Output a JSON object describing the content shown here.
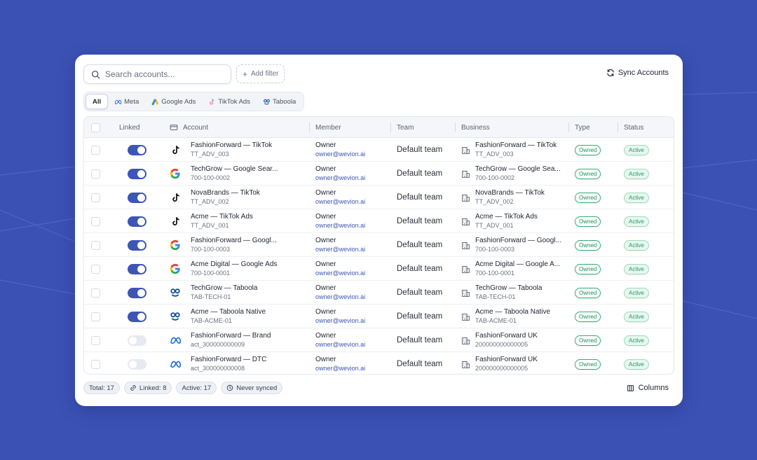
{
  "toolbar": {
    "search_placeholder": "Search accounts...",
    "add_filter_label": "Add filter",
    "sync_label": "Sync Accounts"
  },
  "tabs": [
    {
      "label": "All",
      "icon": "none",
      "active": true
    },
    {
      "label": "Meta",
      "icon": "meta-icon",
      "active": false
    },
    {
      "label": "Google Ads",
      "icon": "google-ads-icon",
      "active": false
    },
    {
      "label": "TikTok Ads",
      "icon": "tiktok-icon",
      "active": false
    },
    {
      "label": "Taboola",
      "icon": "taboola-icon",
      "active": false
    }
  ],
  "table": {
    "headers": {
      "linked": "Linked",
      "account": "Account",
      "member": "Member",
      "team": "Team",
      "business": "Business",
      "type": "Type",
      "status": "Status"
    },
    "rows": [
      {
        "linked": true,
        "platform": "tiktok",
        "account_name": "FashionForward — TikTok",
        "account_id": "TT_ADV_003",
        "member_role": "Owner",
        "member_email": "owner@wevion.ai",
        "team": "Default team",
        "business_name": "FashionForward — TikTok",
        "business_id": "TT_ADV_003",
        "type": "Owned",
        "status": "Active"
      },
      {
        "linked": true,
        "platform": "google",
        "account_name": "TechGrow — Google Sear...",
        "account_id": "700-100-0002",
        "member_role": "Owner",
        "member_email": "owner@wevion.ai",
        "team": "Default team",
        "business_name": "TechGrow — Google Sea...",
        "business_id": "700-100-0002",
        "type": "Owned",
        "status": "Active"
      },
      {
        "linked": true,
        "platform": "tiktok",
        "account_name": "NovaBrands — TikTok",
        "account_id": "TT_ADV_002",
        "member_role": "Owner",
        "member_email": "owner@wevion.ai",
        "team": "Default team",
        "business_name": "NovaBrands — TikTok",
        "business_id": "TT_ADV_002",
        "type": "Owned",
        "status": "Active"
      },
      {
        "linked": true,
        "platform": "tiktok",
        "account_name": "Acme — TikTok Ads",
        "account_id": "TT_ADV_001",
        "member_role": "Owner",
        "member_email": "owner@wevion.ai",
        "team": "Default team",
        "business_name": "Acme — TikTok Ads",
        "business_id": "TT_ADV_001",
        "type": "Owned",
        "status": "Active"
      },
      {
        "linked": true,
        "platform": "google",
        "account_name": "FashionForward — Googl...",
        "account_id": "700-100-0003",
        "member_role": "Owner",
        "member_email": "owner@wevion.ai",
        "team": "Default team",
        "business_name": "FashionForward — Googl...",
        "business_id": "700-100-0003",
        "type": "Owned",
        "status": "Active"
      },
      {
        "linked": true,
        "platform": "google",
        "account_name": "Acme Digital — Google Ads",
        "account_id": "700-100-0001",
        "member_role": "Owner",
        "member_email": "owner@wevion.ai",
        "team": "Default team",
        "business_name": "Acme Digital — Google A...",
        "business_id": "700-100-0001",
        "type": "Owned",
        "status": "Active"
      },
      {
        "linked": true,
        "platform": "taboola",
        "account_name": "TechGrow — Taboola",
        "account_id": "TAB-TECH-01",
        "member_role": "Owner",
        "member_email": "owner@wevion.ai",
        "team": "Default team",
        "business_name": "TechGrow — Taboola",
        "business_id": "TAB-TECH-01",
        "type": "Owned",
        "status": "Active"
      },
      {
        "linked": true,
        "platform": "taboola",
        "account_name": "Acme — Taboola Native",
        "account_id": "TAB-ACME-01",
        "member_role": "Owner",
        "member_email": "owner@wevion.ai",
        "team": "Default team",
        "business_name": "Acme — Taboola Native",
        "business_id": "TAB-ACME-01",
        "type": "Owned",
        "status": "Active"
      },
      {
        "linked": false,
        "platform": "meta",
        "account_name": "FashionForward — Brand",
        "account_id": "act_300000000009",
        "member_role": "Owner",
        "member_email": "owner@wevion.ai",
        "team": "Default team",
        "business_name": "FashionForward UK",
        "business_id": "200000000000005",
        "type": "Owned",
        "status": "Active"
      },
      {
        "linked": false,
        "platform": "meta",
        "account_name": "FashionForward — DTC",
        "account_id": "act_300000000008",
        "member_role": "Owner",
        "member_email": "owner@wevion.ai",
        "team": "Default team",
        "business_name": "FashionForward UK",
        "business_id": "200000000000005",
        "type": "Owned",
        "status": "Active"
      }
    ]
  },
  "footer": {
    "total": "Total: 17",
    "linked": "Linked: 8",
    "active": "Active: 17",
    "sync_state": "Never synced",
    "columns_label": "Columns"
  },
  "colors": {
    "background": "#3b52b4",
    "accent": "#3d55b5",
    "owned": "#2fae77",
    "active_bg": "#e7f7ef"
  }
}
